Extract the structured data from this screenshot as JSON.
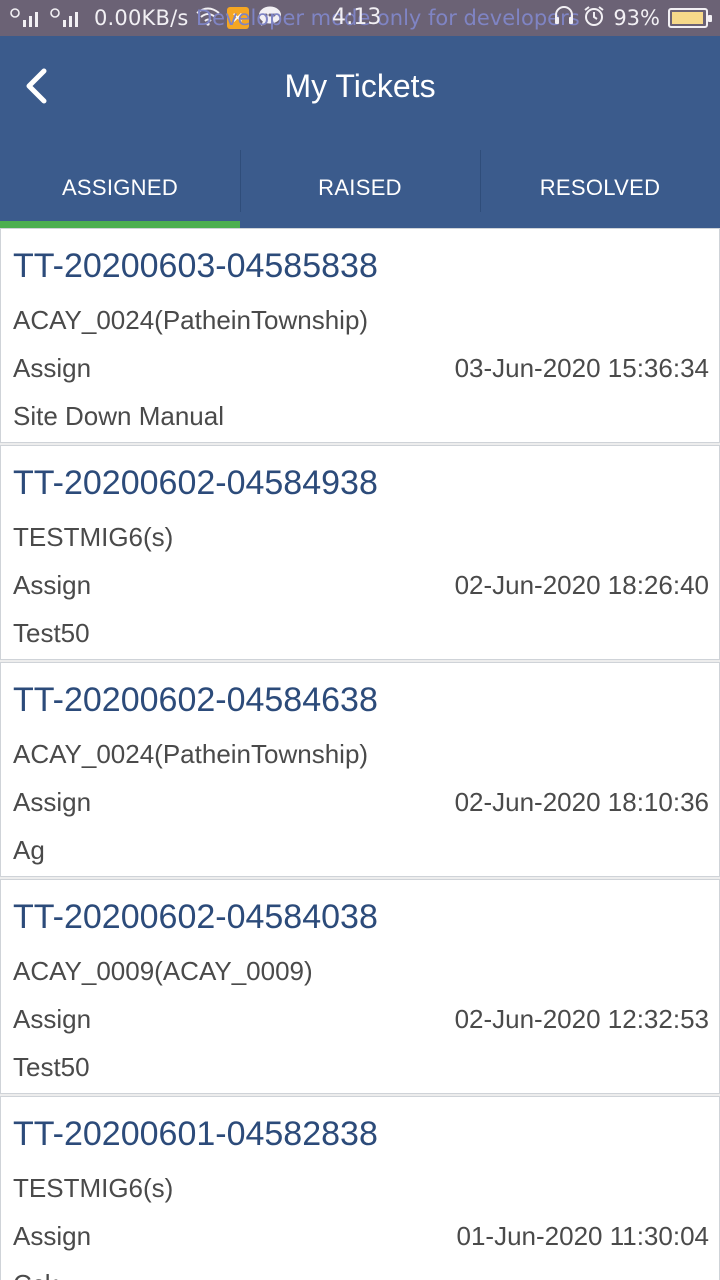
{
  "status_bar": {
    "network_speed": "0.00KB/s",
    "overlay_text": "Developer mode only for developers",
    "time": "4:13",
    "battery": "93%",
    "icons": [
      "signal-icon",
      "signal-icon",
      "wifi-icon",
      "app-notification-icon",
      "chat-icon",
      "headset-icon",
      "alarm-icon",
      "battery-icon"
    ]
  },
  "header": {
    "title": "My Tickets",
    "back_icon": "chevron-left-icon",
    "background": "#3b5b8c"
  },
  "tabs": [
    {
      "label": "ASSIGNED",
      "active": true
    },
    {
      "label": "RAISED",
      "active": false
    },
    {
      "label": "RESOLVED",
      "active": false
    }
  ],
  "colors": {
    "active_tab_indicator": "#4caf50",
    "ticket_id": "#2c4b7a"
  },
  "tickets": [
    {
      "id": "TT-20200603-04585838",
      "site": "ACAY_0024(PatheinTownship)",
      "status": "Assign",
      "date": "03-Jun-2020 15:36:34",
      "description": "Site Down Manual"
    },
    {
      "id": "TT-20200602-04584938",
      "site": "TESTMIG6(s)",
      "status": "Assign",
      "date": "02-Jun-2020 18:26:40",
      "description": "Test50"
    },
    {
      "id": "TT-20200602-04584638",
      "site": "ACAY_0024(PatheinTownship)",
      "status": "Assign",
      "date": "02-Jun-2020 18:10:36",
      "description": "Ag"
    },
    {
      "id": "TT-20200602-04584038",
      "site": "ACAY_0009(ACAY_0009)",
      "status": "Assign",
      "date": "02-Jun-2020 12:32:53",
      "description": "Test50"
    },
    {
      "id": "TT-20200601-04582838",
      "site": "TESTMIG6(s)",
      "status": "Assign",
      "date": "01-Jun-2020 11:30:04",
      "description": "Cck"
    }
  ]
}
